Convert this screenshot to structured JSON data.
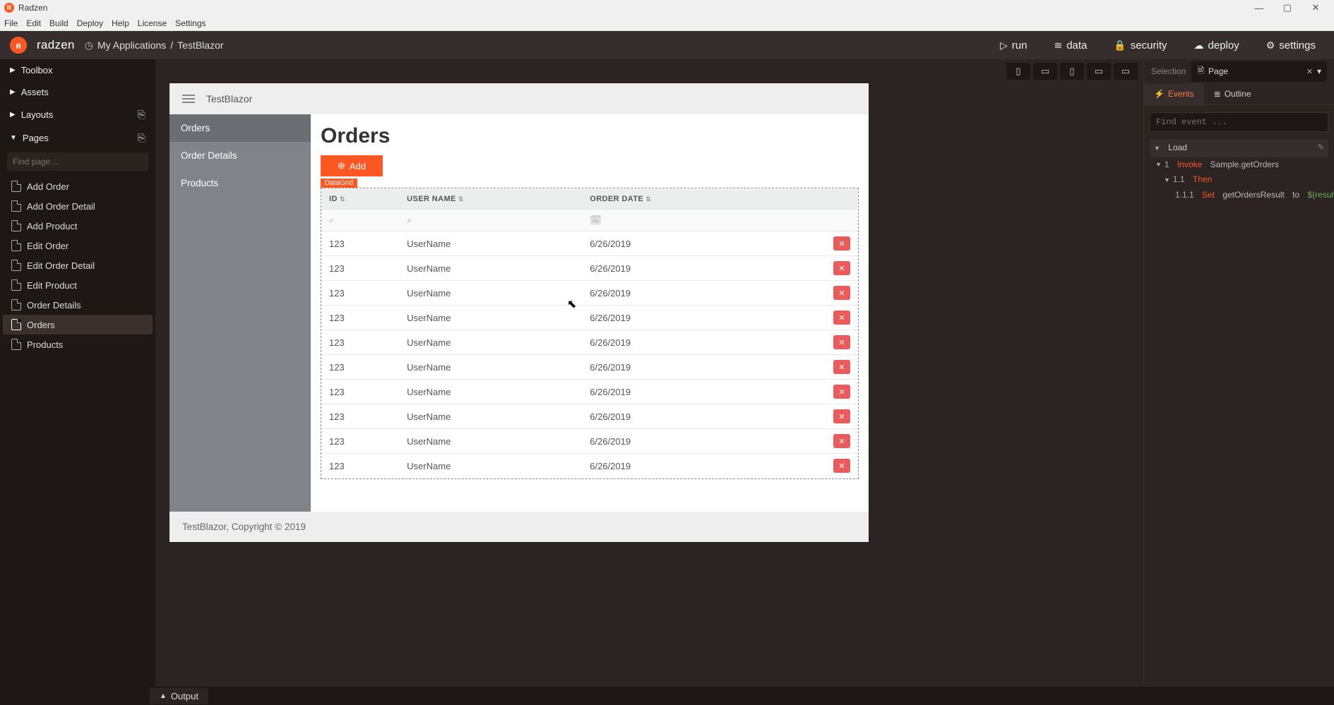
{
  "window": {
    "title": "Radzen"
  },
  "menubar": [
    "File",
    "Edit",
    "Build",
    "Deploy",
    "Help",
    "License",
    "Settings"
  ],
  "brand": {
    "name": "radzen"
  },
  "breadcrumb": {
    "root": "My Applications",
    "page": "TestBlazor"
  },
  "headerActions": {
    "run": "run",
    "data": "data",
    "security": "security",
    "deploy": "deploy",
    "settings": "settings"
  },
  "leftPanel": {
    "sections": {
      "toolbox": "Toolbox",
      "assets": "Assets",
      "layouts": "Layouts",
      "pages": "Pages"
    },
    "search_placeholder": "Find page ...",
    "pages": [
      "Add Order",
      "Add Order Detail",
      "Add Product",
      "Edit Order",
      "Edit Order Detail",
      "Edit Product",
      "Order Details",
      "Orders",
      "Products"
    ],
    "active_page": "Orders"
  },
  "preview": {
    "appTitle": "TestBlazor",
    "nav": [
      "Orders",
      "Order Details",
      "Products"
    ],
    "nav_active": "Orders",
    "pageTitle": "Orders",
    "addButton": "Add",
    "componentLabel": "DataGrid",
    "columns": [
      "ID",
      "USER NAME",
      "ORDER DATE"
    ],
    "rows": [
      {
        "id": "123",
        "user": "UserName",
        "date": "6/26/2019"
      },
      {
        "id": "123",
        "user": "UserName",
        "date": "6/26/2019"
      },
      {
        "id": "123",
        "user": "UserName",
        "date": "6/26/2019"
      },
      {
        "id": "123",
        "user": "UserName",
        "date": "6/26/2019"
      },
      {
        "id": "123",
        "user": "UserName",
        "date": "6/26/2019"
      },
      {
        "id": "123",
        "user": "UserName",
        "date": "6/26/2019"
      },
      {
        "id": "123",
        "user": "UserName",
        "date": "6/26/2019"
      },
      {
        "id": "123",
        "user": "UserName",
        "date": "6/26/2019"
      },
      {
        "id": "123",
        "user": "UserName",
        "date": "6/26/2019"
      },
      {
        "id": "123",
        "user": "UserName",
        "date": "6/26/2019"
      }
    ],
    "footer": "TestBlazor, Copyright © 2019"
  },
  "rightPanel": {
    "selection_label": "Selection",
    "selection_value": "Page",
    "tabs": {
      "events": "Events",
      "outline": "Outline"
    },
    "find_placeholder": "Find event ...",
    "tree": {
      "loadLabel": "Load",
      "l1_index": "1",
      "l1_kw": "Invoke",
      "l1_fn": "Sample.getOrders",
      "l2_index": "1.1",
      "l2_kw": "Then",
      "l3_index": "1.1.1",
      "l3_kw": "Set",
      "l3_var": "getOrdersResult",
      "l3_to": "to",
      "l3_expr": "${result.value}"
    }
  },
  "output": {
    "label": "Output"
  }
}
